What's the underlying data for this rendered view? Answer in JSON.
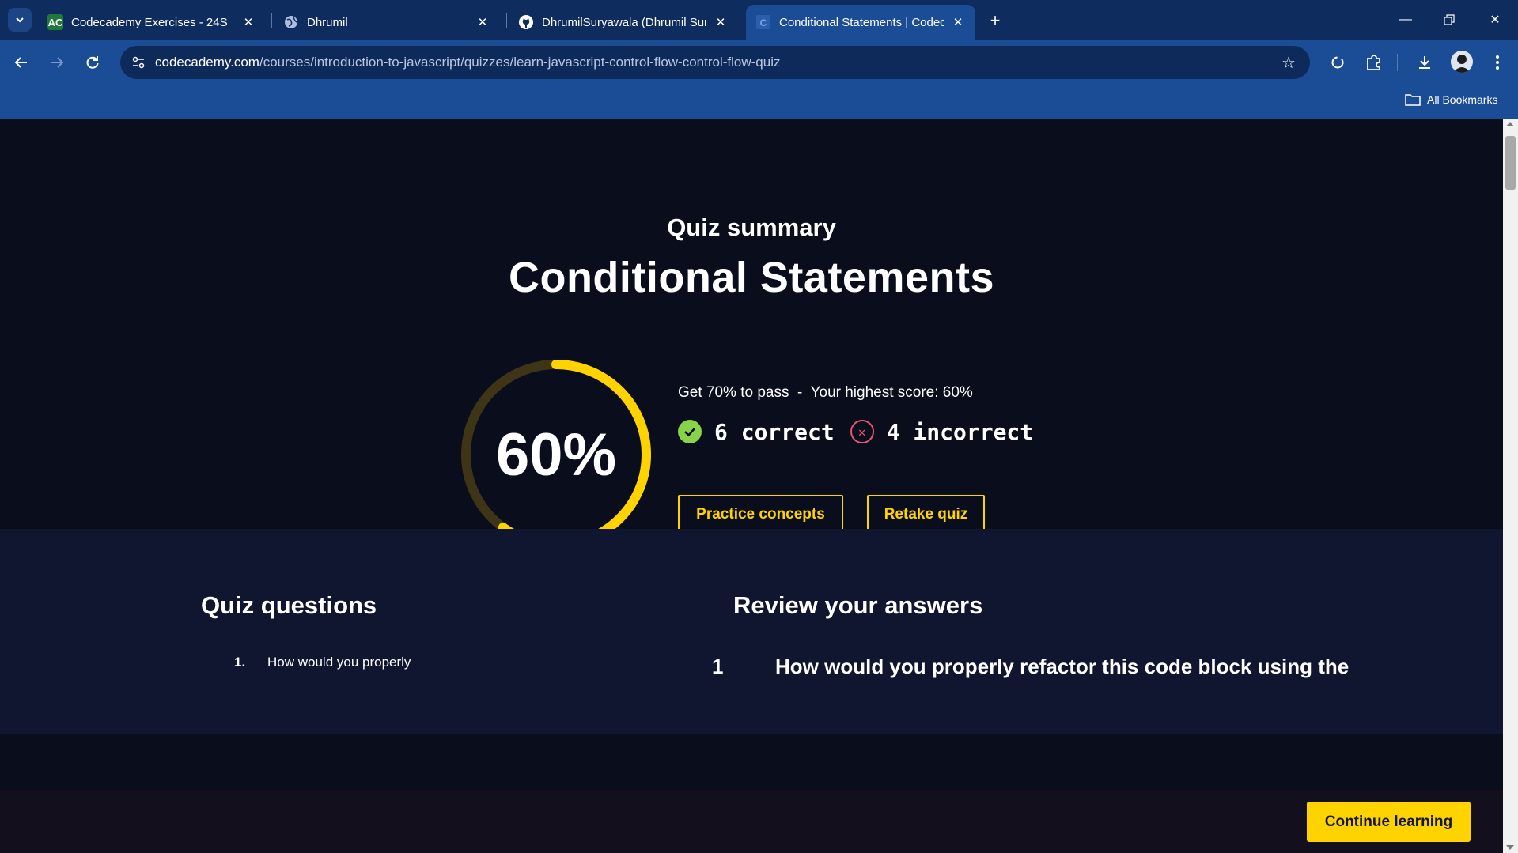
{
  "browser": {
    "tabs": [
      {
        "title": "Codecademy Exercises - 24S_M",
        "icon": "codecademy-sheet-icon",
        "active": false
      },
      {
        "title": "Dhrumil",
        "icon": "globe-icon",
        "active": false
      },
      {
        "title": "DhrumilSuryawala (Dhrumil Sur",
        "icon": "github-icon",
        "active": false
      },
      {
        "title": "Conditional Statements | Codec",
        "icon": "codecademy-icon",
        "active": true
      }
    ],
    "url_domain": "codecademy.com",
    "url_path": "/courses/introduction-to-javascript/quizzes/learn-javascript-control-flow-control-flow-quiz",
    "bookmarks_label": "All Bookmarks"
  },
  "summary": {
    "label": "Quiz summary",
    "title": "Conditional Statements",
    "score_text": "60%",
    "score_fraction": 0.6,
    "pass_info": "Get 70% to pass  -  Your highest score: 60%",
    "correct_text": "6 correct",
    "incorrect_text": "4 incorrect",
    "practice_label": "Practice concepts",
    "retake_label": "Retake quiz"
  },
  "questions": {
    "heading": "Quiz questions",
    "items": [
      {
        "num": "1.",
        "text": "How would you properly"
      }
    ]
  },
  "review": {
    "heading": "Review your answers",
    "items": [
      {
        "num": "1",
        "text": "How would you properly refactor this code block using the"
      }
    ]
  },
  "footer": {
    "continue_label": "Continue learning"
  },
  "colors": {
    "accent": "#ffd300",
    "correct": "#89d34a",
    "incorrect": "#e45770",
    "page_bg": "#0a0d1c",
    "chrome": "#1a4d96"
  }
}
